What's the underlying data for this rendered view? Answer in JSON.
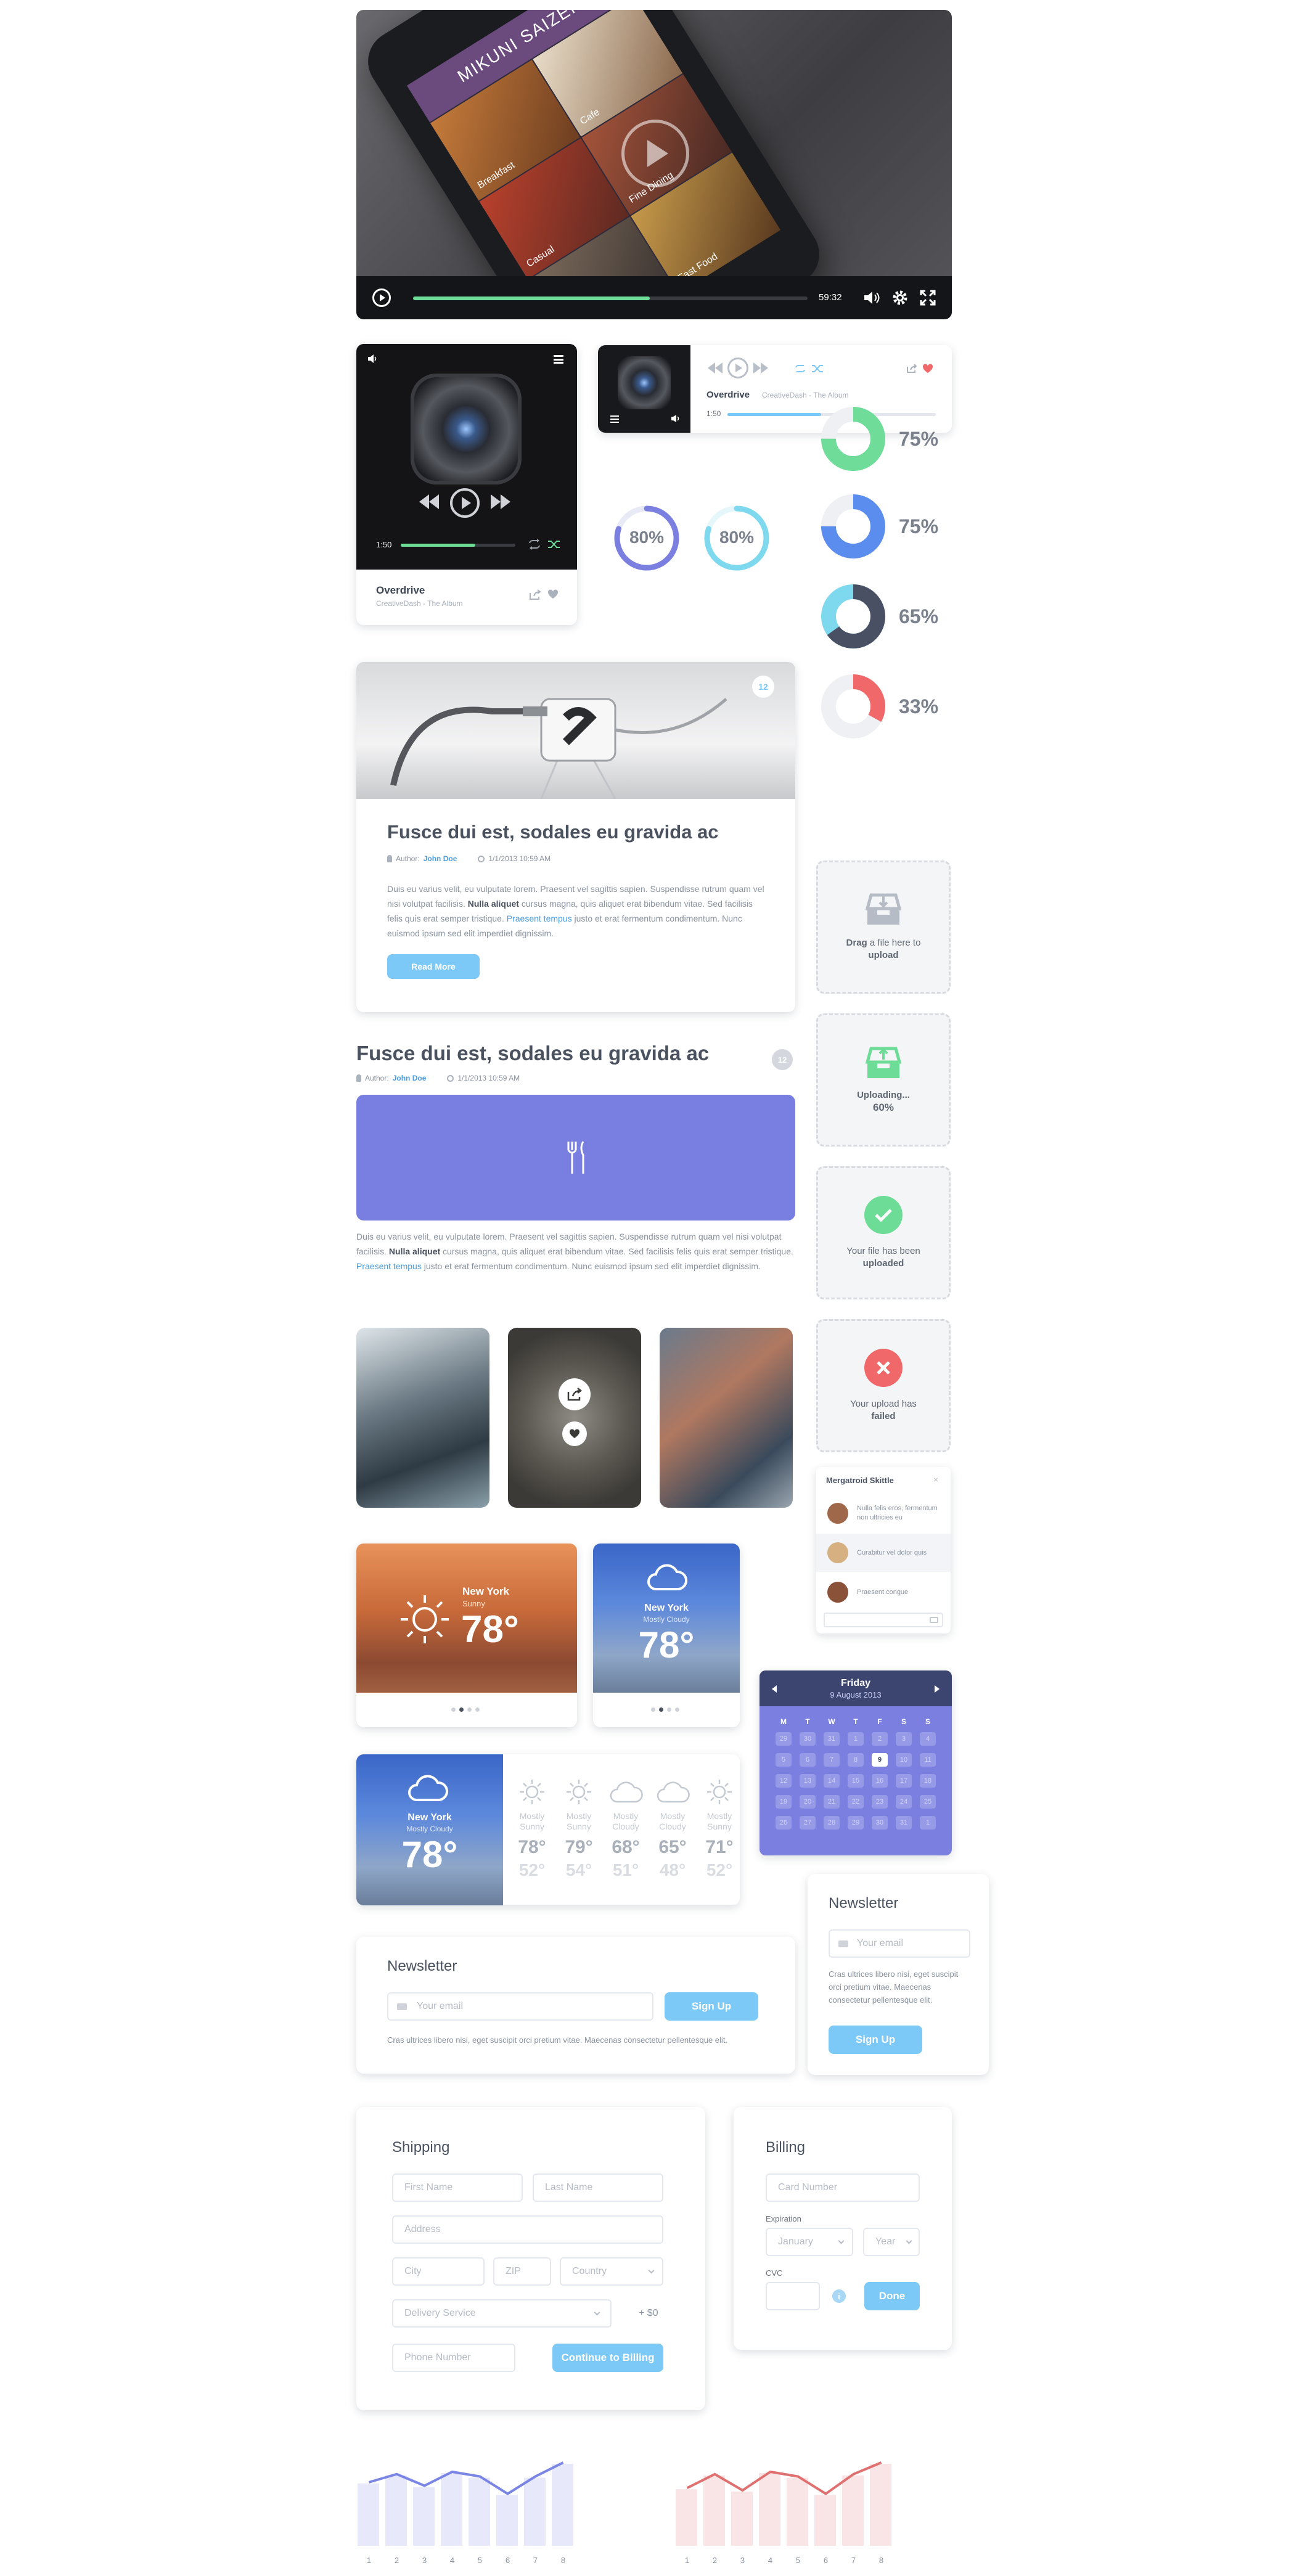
{
  "video": {
    "screen_title": "MIKUNI SAIZEN",
    "tiles": [
      "Breakfast",
      "Cafe",
      "Fine Dining",
      "Casual",
      "Fast Food"
    ],
    "time": "59:32",
    "progress": 0.6
  },
  "music_player": {
    "track": "Overdrive",
    "album": "CreativeDash - The Album",
    "time": "1:50",
    "progress": 0.65
  },
  "mini_player": {
    "track": "Overdrive",
    "album": "CreativeDash - The Album",
    "time": "1:50",
    "progress": 0.45
  },
  "rings": [
    {
      "label": "80%",
      "value": 0.8,
      "color": "#7a7fe0"
    },
    {
      "label": "80%",
      "value": 0.8,
      "color": "#7fd9ee"
    }
  ],
  "donuts": [
    {
      "label": "75%",
      "value": 0.75,
      "color": "#6fdc9a"
    },
    {
      "label": "75%",
      "value": 0.75,
      "color": "#5b8def"
    },
    {
      "label": "65%",
      "value": 0.65,
      "color": "#4a5064"
    },
    {
      "label": "33%",
      "value": 0.33,
      "color": "#f0686a"
    }
  ],
  "blog_card": {
    "badge": "12",
    "title": "Fusce dui est, sodales eu gravida ac",
    "author_label": "Author:",
    "author": "John Doe",
    "date": "1/1/2013 10:59 AM",
    "body_1": "Duis eu varius velit, eu vulputate lorem. Praesent vel sagittis sapien. Suspendisse rutrum quam vel nisi volutpat facilisis.",
    "body_bold": "Nulla aliquet",
    "body_2": "cursus magna, quis aliquet erat bibendum vitae. Sed facilisis felis quis erat semper tristique.",
    "body_link": "Praesent tempus",
    "body_3": "justo et erat fermentum condimentum. Nunc euismod ipsum sed elit imperdiet dignissim.",
    "button": "Read More"
  },
  "blog_post": {
    "badge": "12",
    "title": "Fusce dui est, sodales eu gravida ac",
    "author_label": "Author:",
    "author": "John Doe",
    "date": "1/1/2013 10:59 AM",
    "body_1": "Duis eu varius velit, eu vulputate lorem. Praesent vel sagittis sapien. Suspendisse rutrum quam vel nisi volutpat facilisis.",
    "body_bold": "Nulla aliquet",
    "body_2": "cursus magna, quis aliquet erat bibendum vitae. Sed facilisis felis quis erat semper tristique.",
    "body_link": "Praesent tempus",
    "body_3": "justo et erat fermentum condimentum. Nunc euismod ipsum sed elit imperdiet dignissim."
  },
  "upload": {
    "drag_1": "Drag",
    "drag_2": "a file here to",
    "drag_3": "upload",
    "uploading": "Uploading...",
    "percent": "60%",
    "done_1": "Your file has been",
    "done_2": "uploaded",
    "fail_1": "Your upload has",
    "fail_2": "failed"
  },
  "chat": {
    "name": "Mergatroid Skittle",
    "messages": [
      "Nulla felis eros, fermentum non ultricies eu",
      "Curabitur vel dolor quis",
      "Praesent congue"
    ]
  },
  "weather_large": {
    "city": "New York",
    "condition": "Sunny",
    "temp": "78°"
  },
  "weather_small": {
    "city": "New York",
    "condition": "Mostly Cloudy",
    "temp": "78°"
  },
  "calendar": {
    "day": "Friday",
    "date": "9 August 2013",
    "weekdays": [
      "M",
      "T",
      "W",
      "T",
      "F",
      "S",
      "S"
    ],
    "days": [
      "29",
      "30",
      "31",
      "1",
      "2",
      "3",
      "4",
      "5",
      "6",
      "7",
      "8",
      "9",
      "10",
      "11",
      "12",
      "13",
      "14",
      "15",
      "16",
      "17",
      "18",
      "19",
      "20",
      "21",
      "22",
      "23",
      "24",
      "25",
      "26",
      "27",
      "28",
      "29",
      "30",
      "31",
      "1"
    ],
    "selected": "9"
  },
  "forecast": {
    "city": "New York",
    "condition": "Mostly Cloudy",
    "temp": "78°",
    "days": [
      {
        "icon": "sun",
        "label": [
          "Mostly",
          "Sunny"
        ],
        "hi": "78°",
        "lo": "52°"
      },
      {
        "icon": "sun",
        "label": [
          "Mostly",
          "Sunny"
        ],
        "hi": "79°",
        "lo": "54°"
      },
      {
        "icon": "cloud",
        "label": [
          "Mostly",
          "Cloudy"
        ],
        "hi": "68°",
        "lo": "51°"
      },
      {
        "icon": "cloud",
        "label": [
          "Mostly",
          "Cloudy"
        ],
        "hi": "65°",
        "lo": "48°"
      },
      {
        "icon": "sun",
        "label": [
          "Mostly",
          "Sunny"
        ],
        "hi": "71°",
        "lo": "52°"
      }
    ]
  },
  "newsletter_wide": {
    "title": "Newsletter",
    "placeholder": "Your email",
    "button": "Sign Up",
    "text": "Cras ultrices libero nisi, eget suscipit orci pretium vitae. Maecenas consectetur pellentesque elit."
  },
  "newsletter_narrow": {
    "title": "Newsletter",
    "placeholder": "Your email",
    "text": "Cras ultrices libero nisi, eget suscipit orci pretium vitae. Maecenas consectetur pellentesque elit.",
    "button": "Sign Up"
  },
  "shipping": {
    "title": "Shipping",
    "first_name": "First Name",
    "last_name": "Last Name",
    "address": "Address",
    "city": "City",
    "zip": "ZIP",
    "country": "Country",
    "delivery": "Delivery Service",
    "price": "+ $0",
    "phone": "Phone Number",
    "button": "Continue to Billing"
  },
  "billing": {
    "title": "Billing",
    "card_number": "Card Number",
    "expiration": "Expiration",
    "month": "January",
    "year": "Year",
    "cvc": "CVC",
    "button": "Done"
  },
  "chart_data": [
    {
      "type": "area",
      "x": [
        "1",
        "2",
        "3",
        "4",
        "5",
        "6",
        "7",
        "8"
      ],
      "series": [
        {
          "values": [
            55,
            62,
            52,
            64,
            60,
            45,
            60,
            72
          ]
        }
      ],
      "ylim": [
        0,
        80
      ],
      "color": "#7a86e6"
    },
    {
      "type": "area",
      "x": [
        "1",
        "2",
        "3",
        "4",
        "5",
        "6",
        "7",
        "8"
      ],
      "series": [
        {
          "values": [
            50,
            62,
            48,
            64,
            60,
            45,
            62,
            72
          ]
        }
      ],
      "ylim": [
        0,
        80
      ],
      "color": "#e07070"
    }
  ]
}
